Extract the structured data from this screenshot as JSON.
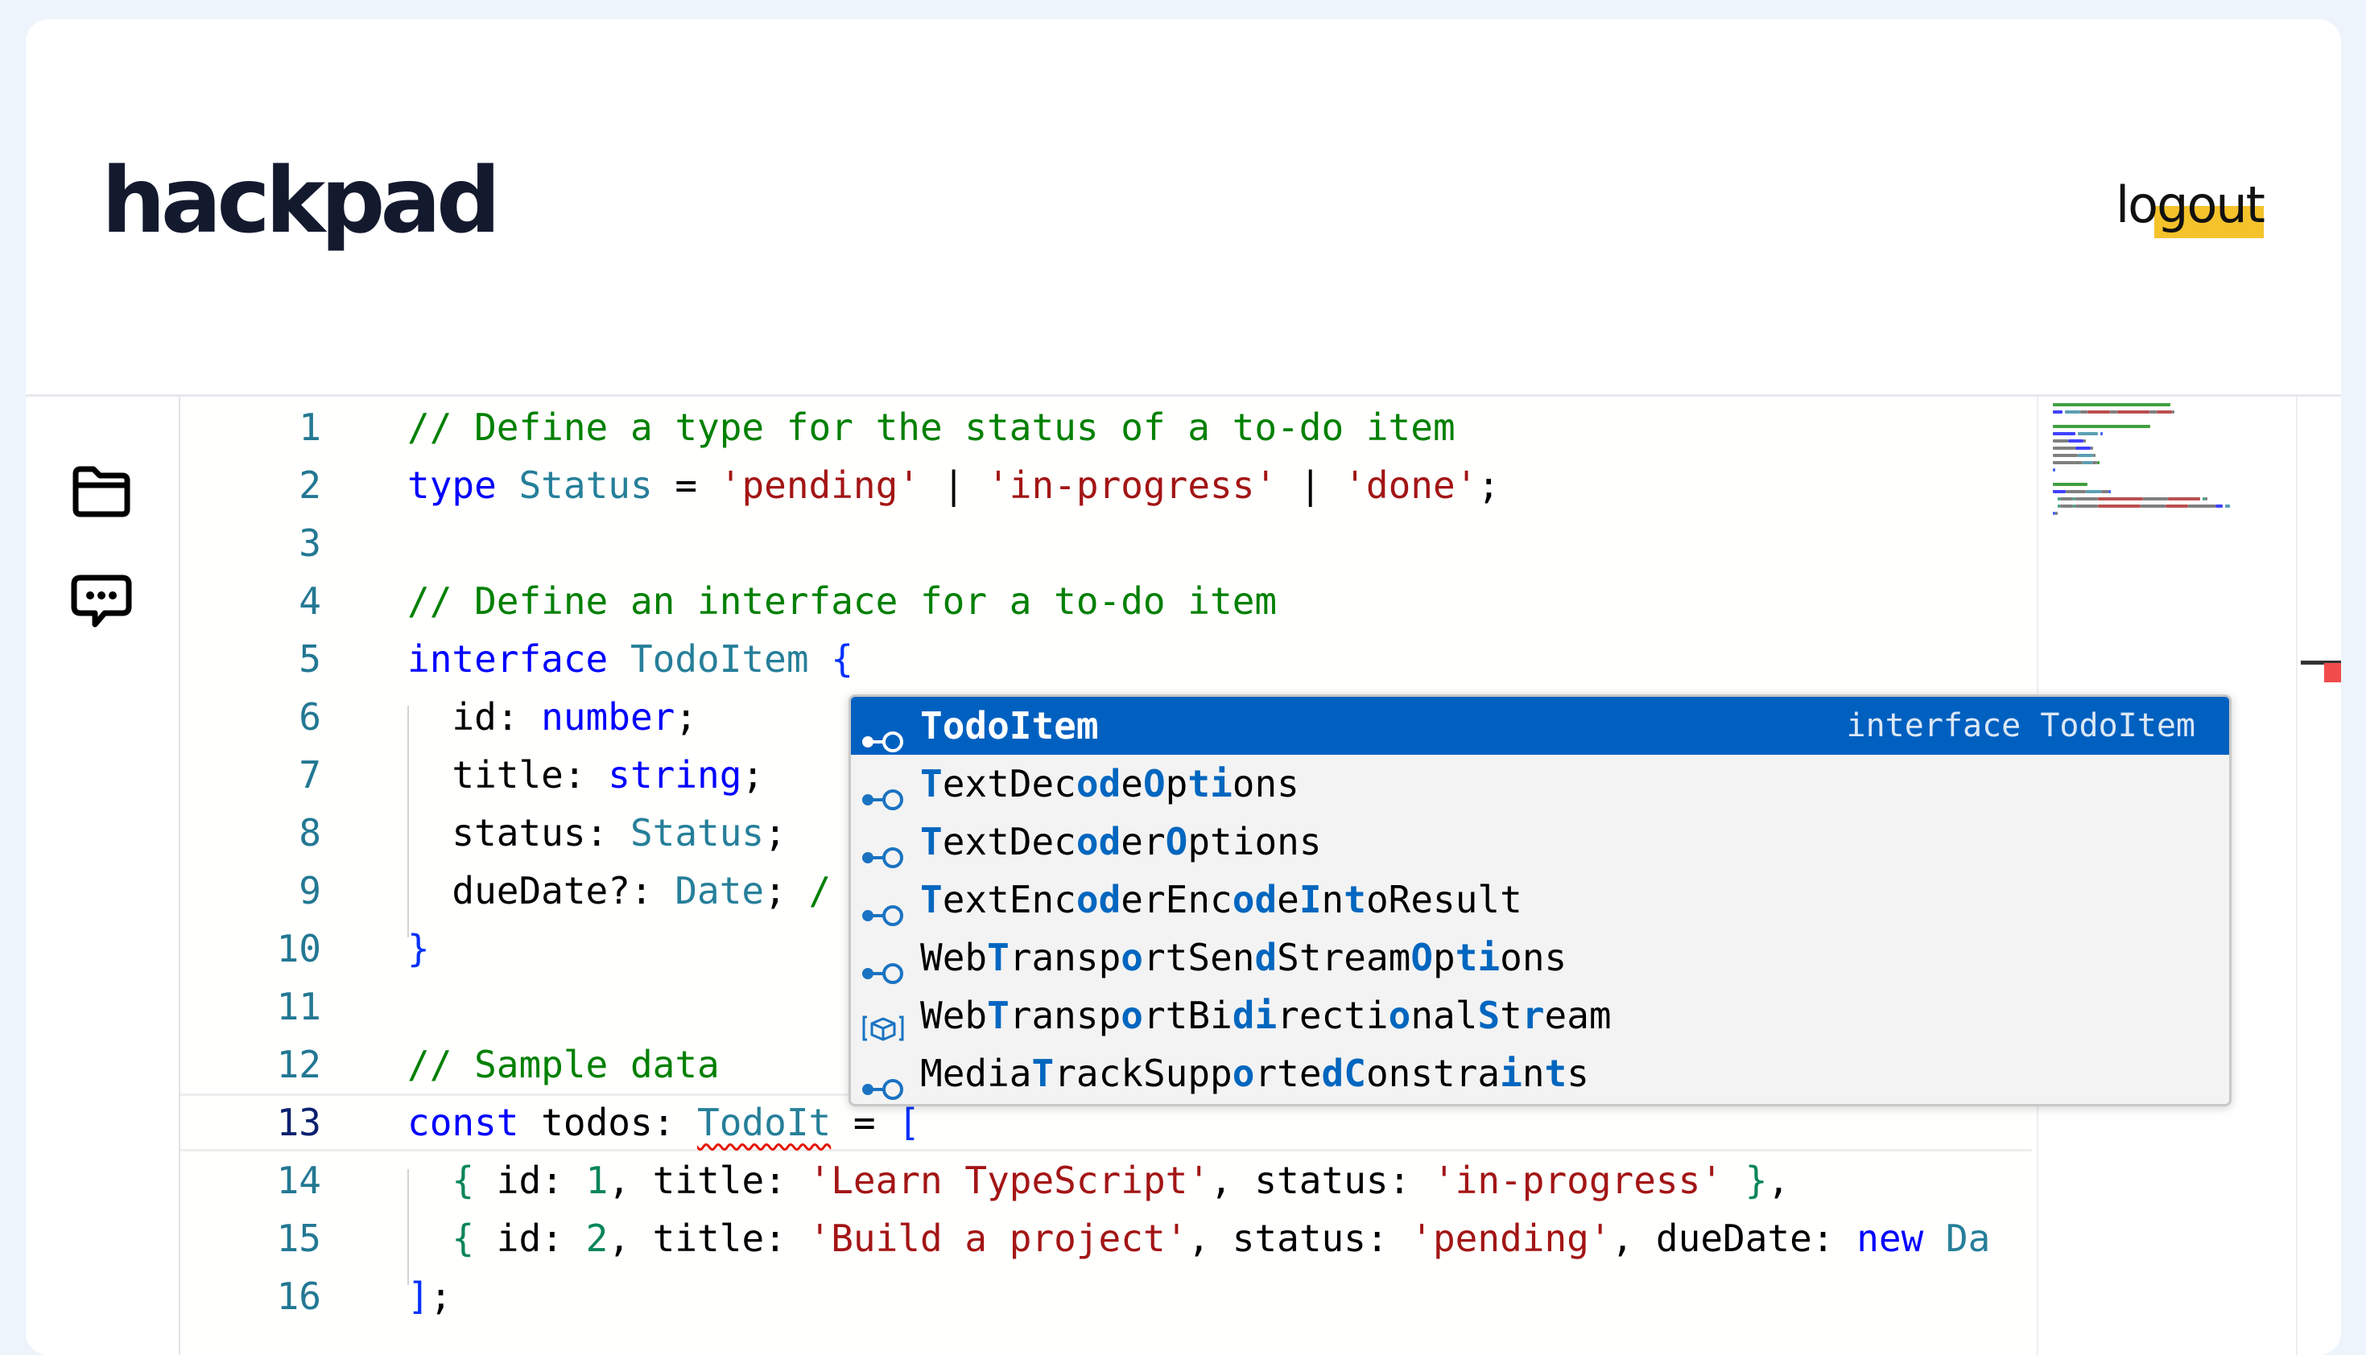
{
  "app": {
    "logo": "hackpad",
    "logout_label": "logout",
    "accent_color": "#f4c22b"
  },
  "sidebar": {
    "items": [
      {
        "icon": "folder-icon"
      },
      {
        "icon": "chat-icon"
      }
    ]
  },
  "editor": {
    "current_line": 13,
    "lines": [
      {
        "n": "1",
        "tokens": [
          {
            "t": "// Define a type for the status of a to-do item",
            "k": "cm"
          }
        ]
      },
      {
        "n": "2",
        "tokens": [
          {
            "t": "type",
            "k": "kw"
          },
          {
            "t": " ",
            "k": ""
          },
          {
            "t": "Status",
            "k": "ty"
          },
          {
            "t": " = ",
            "k": ""
          },
          {
            "t": "'pending'",
            "k": "st"
          },
          {
            "t": " | ",
            "k": ""
          },
          {
            "t": "'in-progress'",
            "k": "st"
          },
          {
            "t": " | ",
            "k": ""
          },
          {
            "t": "'done'",
            "k": "st"
          },
          {
            "t": ";",
            "k": ""
          }
        ]
      },
      {
        "n": "3",
        "tokens": []
      },
      {
        "n": "4",
        "tokens": [
          {
            "t": "// Define an interface for a to-do item",
            "k": "cm"
          }
        ]
      },
      {
        "n": "5",
        "tokens": [
          {
            "t": "interface",
            "k": "kw"
          },
          {
            "t": " ",
            "k": ""
          },
          {
            "t": "TodoItem",
            "k": "ty"
          },
          {
            "t": " ",
            "k": ""
          },
          {
            "t": "{",
            "k": "br"
          }
        ]
      },
      {
        "n": "6",
        "tokens": [
          {
            "t": "  id: ",
            "k": ""
          },
          {
            "t": "number",
            "k": "kw"
          },
          {
            "t": ";",
            "k": ""
          }
        ]
      },
      {
        "n": "7",
        "tokens": [
          {
            "t": "  title: ",
            "k": ""
          },
          {
            "t": "string",
            "k": "kw"
          },
          {
            "t": ";",
            "k": ""
          }
        ]
      },
      {
        "n": "8",
        "tokens": [
          {
            "t": "  status: ",
            "k": ""
          },
          {
            "t": "Status",
            "k": "ty"
          },
          {
            "t": ";",
            "k": ""
          }
        ]
      },
      {
        "n": "9",
        "tokens": [
          {
            "t": "  dueDate?: ",
            "k": ""
          },
          {
            "t": "Date",
            "k": "ty"
          },
          {
            "t": "; ",
            "k": ""
          },
          {
            "t": "/",
            "k": "cm"
          }
        ]
      },
      {
        "n": "10",
        "tokens": [
          {
            "t": "}",
            "k": "br"
          }
        ]
      },
      {
        "n": "11",
        "tokens": []
      },
      {
        "n": "12",
        "tokens": [
          {
            "t": "// Sample data",
            "k": "cm"
          }
        ]
      },
      {
        "n": "13",
        "tokens": [
          {
            "t": "const",
            "k": "kw"
          },
          {
            "t": " todos: ",
            "k": ""
          },
          {
            "t": "TodoIt",
            "k": "ty err"
          },
          {
            "t": " = ",
            "k": ""
          },
          {
            "t": "[",
            "k": "br"
          }
        ]
      },
      {
        "n": "14",
        "tokens": [
          {
            "t": "  ",
            "k": ""
          },
          {
            "t": "{",
            "k": "nu"
          },
          {
            "t": " id: ",
            "k": ""
          },
          {
            "t": "1",
            "k": "nu"
          },
          {
            "t": ", title: ",
            "k": ""
          },
          {
            "t": "'Learn TypeScript'",
            "k": "st"
          },
          {
            "t": ", status: ",
            "k": ""
          },
          {
            "t": "'in-progress'",
            "k": "st"
          },
          {
            "t": " ",
            "k": ""
          },
          {
            "t": "}",
            "k": "nu"
          },
          {
            "t": ",",
            "k": ""
          }
        ]
      },
      {
        "n": "15",
        "tokens": [
          {
            "t": "  ",
            "k": ""
          },
          {
            "t": "{",
            "k": "nu"
          },
          {
            "t": " id: ",
            "k": ""
          },
          {
            "t": "2",
            "k": "nu"
          },
          {
            "t": ", title: ",
            "k": ""
          },
          {
            "t": "'Build a project'",
            "k": "st"
          },
          {
            "t": ", status: ",
            "k": ""
          },
          {
            "t": "'pending'",
            "k": "st"
          },
          {
            "t": ", dueDate: ",
            "k": ""
          },
          {
            "t": "new",
            "k": "kw"
          },
          {
            "t": " ",
            "k": ""
          },
          {
            "t": "Da",
            "k": "ty"
          }
        ]
      },
      {
        "n": "16",
        "tokens": [
          {
            "t": "]",
            "k": "br"
          },
          {
            "t": ";",
            "k": ""
          }
        ]
      }
    ]
  },
  "suggestions": {
    "selected_index": 0,
    "items": [
      {
        "icon": "interface-icon",
        "parts": [
          {
            "t": "TodoItem",
            "m": true
          }
        ],
        "detail": "interface TodoItem"
      },
      {
        "icon": "interface-icon",
        "parts": [
          {
            "t": "T",
            "m": true
          },
          {
            "t": "extDec",
            "m": false
          },
          {
            "t": "od",
            "m": true
          },
          {
            "t": "e",
            "m": false
          },
          {
            "t": "O",
            "m": true
          },
          {
            "t": "p",
            "m": false
          },
          {
            "t": "ti",
            "m": true
          },
          {
            "t": "ons",
            "m": false
          }
        ],
        "detail": ""
      },
      {
        "icon": "interface-icon",
        "parts": [
          {
            "t": "T",
            "m": true
          },
          {
            "t": "extDec",
            "m": false
          },
          {
            "t": "od",
            "m": true
          },
          {
            "t": "er",
            "m": false
          },
          {
            "t": "O",
            "m": true
          },
          {
            "t": "ptions",
            "m": false
          }
        ],
        "detail": ""
      },
      {
        "icon": "interface-icon",
        "parts": [
          {
            "t": "T",
            "m": true
          },
          {
            "t": "extEnc",
            "m": false
          },
          {
            "t": "od",
            "m": true
          },
          {
            "t": "erEnc",
            "m": false
          },
          {
            "t": "od",
            "m": true
          },
          {
            "t": "e",
            "m": false
          },
          {
            "t": "I",
            "m": true
          },
          {
            "t": "n",
            "m": false
          },
          {
            "t": "t",
            "m": true
          },
          {
            "t": "oResult",
            "m": false
          }
        ],
        "detail": ""
      },
      {
        "icon": "interface-icon",
        "parts": [
          {
            "t": "Web",
            "m": false
          },
          {
            "t": "T",
            "m": true
          },
          {
            "t": "ransp",
            "m": false
          },
          {
            "t": "o",
            "m": true
          },
          {
            "t": "rtSen",
            "m": false
          },
          {
            "t": "d",
            "m": true
          },
          {
            "t": "Stream",
            "m": false
          },
          {
            "t": "O",
            "m": true
          },
          {
            "t": "p",
            "m": false
          },
          {
            "t": "ti",
            "m": true
          },
          {
            "t": "ons",
            "m": false
          }
        ],
        "detail": ""
      },
      {
        "icon": "class-icon",
        "parts": [
          {
            "t": "Web",
            "m": false
          },
          {
            "t": "T",
            "m": true
          },
          {
            "t": "ransp",
            "m": false
          },
          {
            "t": "o",
            "m": true
          },
          {
            "t": "rtBi",
            "m": false
          },
          {
            "t": "di",
            "m": true
          },
          {
            "t": "recti",
            "m": false
          },
          {
            "t": "o",
            "m": true
          },
          {
            "t": "nal",
            "m": false
          },
          {
            "t": "S",
            "m": true
          },
          {
            "t": "t",
            "m": false
          },
          {
            "t": "r",
            "m": true
          },
          {
            "t": "eam",
            "m": false
          }
        ],
        "detail": ""
      },
      {
        "icon": "interface-icon",
        "parts": [
          {
            "t": "Media",
            "m": false
          },
          {
            "t": "T",
            "m": true
          },
          {
            "t": "rackSupp",
            "m": false
          },
          {
            "t": "o",
            "m": true
          },
          {
            "t": "rte",
            "m": false
          },
          {
            "t": "d",
            "m": true
          },
          {
            "t": "C",
            "m": true
          },
          {
            "t": "o",
            "m": false
          },
          {
            "t": "nstra",
            "m": false
          },
          {
            "t": "i",
            "m": true
          },
          {
            "t": "n",
            "m": false
          },
          {
            "t": "t",
            "m": true
          },
          {
            "t": "s",
            "m": false
          }
        ],
        "detail": ""
      }
    ]
  }
}
